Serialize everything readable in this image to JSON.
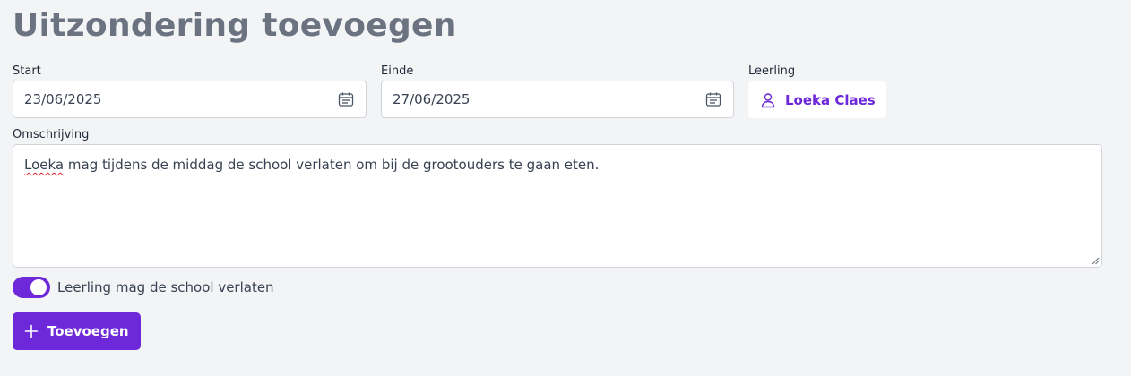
{
  "page": {
    "title": "Uitzondering toevoegen"
  },
  "form": {
    "start": {
      "label": "Start",
      "value": "23/06/2025",
      "icon": "calendar-icon"
    },
    "end": {
      "label": "Einde",
      "value": "27/06/2025",
      "icon": "calendar-icon"
    },
    "student": {
      "label": "Leerling",
      "name": "Loeka Claes",
      "icon": "person-icon"
    },
    "description": {
      "label": "Omschrijving",
      "misspelled_word": "Loeka",
      "rest": " mag tijdens de middag de school verlaten om bij de grootouders te gaan eten."
    },
    "leave_school_toggle": {
      "label": "Leerling mag de school verlaten",
      "checked": true
    },
    "submit": {
      "label": "Toevoegen",
      "icon": "plus-icon"
    }
  },
  "colors": {
    "accent": "#6d28d9",
    "title": "#6b7280",
    "background": "#f3f4f6"
  }
}
